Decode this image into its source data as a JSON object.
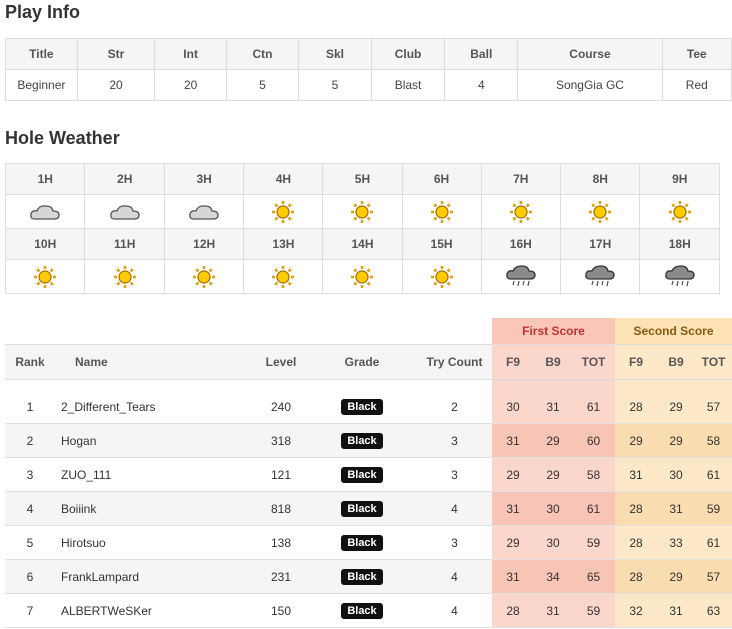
{
  "play_info": {
    "heading": "Play Info",
    "headers": [
      "Title",
      "Str",
      "Int",
      "Ctn",
      "Skl",
      "Club",
      "Ball",
      "Course",
      "Tee"
    ],
    "values": [
      "Beginner",
      "20",
      "20",
      "5",
      "5",
      "Blast",
      "4",
      "SongGia GC",
      "Red"
    ]
  },
  "hole_weather": {
    "heading": "Hole Weather",
    "row1": [
      {
        "hole": "1H",
        "icon": "cloud-icon"
      },
      {
        "hole": "2H",
        "icon": "cloud-icon"
      },
      {
        "hole": "3H",
        "icon": "cloud-icon"
      },
      {
        "hole": "4H",
        "icon": "sun-icon"
      },
      {
        "hole": "5H",
        "icon": "sun-icon"
      },
      {
        "hole": "6H",
        "icon": "sun-icon"
      },
      {
        "hole": "7H",
        "icon": "sun-icon"
      },
      {
        "hole": "8H",
        "icon": "sun-icon"
      },
      {
        "hole": "9H",
        "icon": "sun-icon"
      }
    ],
    "row2": [
      {
        "hole": "10H",
        "icon": "sun-icon"
      },
      {
        "hole": "11H",
        "icon": "sun-icon"
      },
      {
        "hole": "12H",
        "icon": "sun-icon"
      },
      {
        "hole": "13H",
        "icon": "sun-icon"
      },
      {
        "hole": "14H",
        "icon": "sun-icon"
      },
      {
        "hole": "15H",
        "icon": "sun-icon"
      },
      {
        "hole": "16H",
        "icon": "rain-cloud-icon"
      },
      {
        "hole": "17H",
        "icon": "rain-cloud-icon"
      },
      {
        "hole": "18H",
        "icon": "rain-cloud-icon"
      }
    ]
  },
  "ranking": {
    "first_score_label": "First Score",
    "second_score_label": "Second Score",
    "headers": {
      "rank": "Rank",
      "name": "Name",
      "level": "Level",
      "grade": "Grade",
      "try_count": "Try Count",
      "f9": "F9",
      "b9": "B9",
      "tot": "TOT"
    },
    "rows": [
      {
        "rank": "1",
        "name": "2_Different_Tears",
        "level": "240",
        "grade": "Black",
        "try": "2",
        "s1": [
          "30",
          "31",
          "61"
        ],
        "s2": [
          "28",
          "29",
          "57"
        ]
      },
      {
        "rank": "2",
        "name": "Hogan",
        "level": "318",
        "grade": "Black",
        "try": "3",
        "s1": [
          "31",
          "29",
          "60"
        ],
        "s2": [
          "29",
          "29",
          "58"
        ]
      },
      {
        "rank": "3",
        "name": "ZUO_111",
        "level": "121",
        "grade": "Black",
        "try": "3",
        "s1": [
          "29",
          "29",
          "58"
        ],
        "s2": [
          "31",
          "30",
          "61"
        ]
      },
      {
        "rank": "4",
        "name": "Boiiink",
        "level": "818",
        "grade": "Black",
        "try": "4",
        "s1": [
          "31",
          "30",
          "61"
        ],
        "s2": [
          "28",
          "31",
          "59"
        ]
      },
      {
        "rank": "5",
        "name": "Hirotsuo",
        "level": "138",
        "grade": "Black",
        "try": "3",
        "s1": [
          "29",
          "30",
          "59"
        ],
        "s2": [
          "28",
          "33",
          "61"
        ]
      },
      {
        "rank": "6",
        "name": "FrankLampard",
        "level": "231",
        "grade": "Black",
        "try": "4",
        "s1": [
          "31",
          "34",
          "65"
        ],
        "s2": [
          "28",
          "29",
          "57"
        ]
      },
      {
        "rank": "7",
        "name": "ALBERTWeSKer",
        "level": "150",
        "grade": "Black",
        "try": "4",
        "s1": [
          "28",
          "31",
          "59"
        ],
        "s2": [
          "32",
          "31",
          "63"
        ]
      }
    ]
  }
}
